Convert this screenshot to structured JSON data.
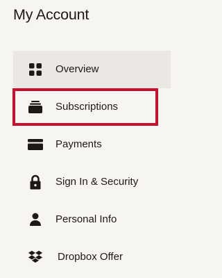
{
  "header": {
    "title": "My Account"
  },
  "nav": {
    "items": [
      {
        "label": "Overview",
        "icon": "grid-icon"
      },
      {
        "label": "Subscriptions",
        "icon": "subscriptions-icon"
      },
      {
        "label": "Payments",
        "icon": "credit-card-icon"
      },
      {
        "label": "Sign In & Security",
        "icon": "lock-icon"
      },
      {
        "label": "Personal Info",
        "icon": "person-icon"
      },
      {
        "label": "Dropbox Offer",
        "icon": "dropbox-icon"
      }
    ],
    "active_item": "Overview",
    "highlighted_item": "Subscriptions"
  },
  "colors": {
    "background": "#f7f5f2",
    "active_background": "#ebe8e3",
    "text": "#1e1919",
    "highlight_border": "#c8102e"
  }
}
